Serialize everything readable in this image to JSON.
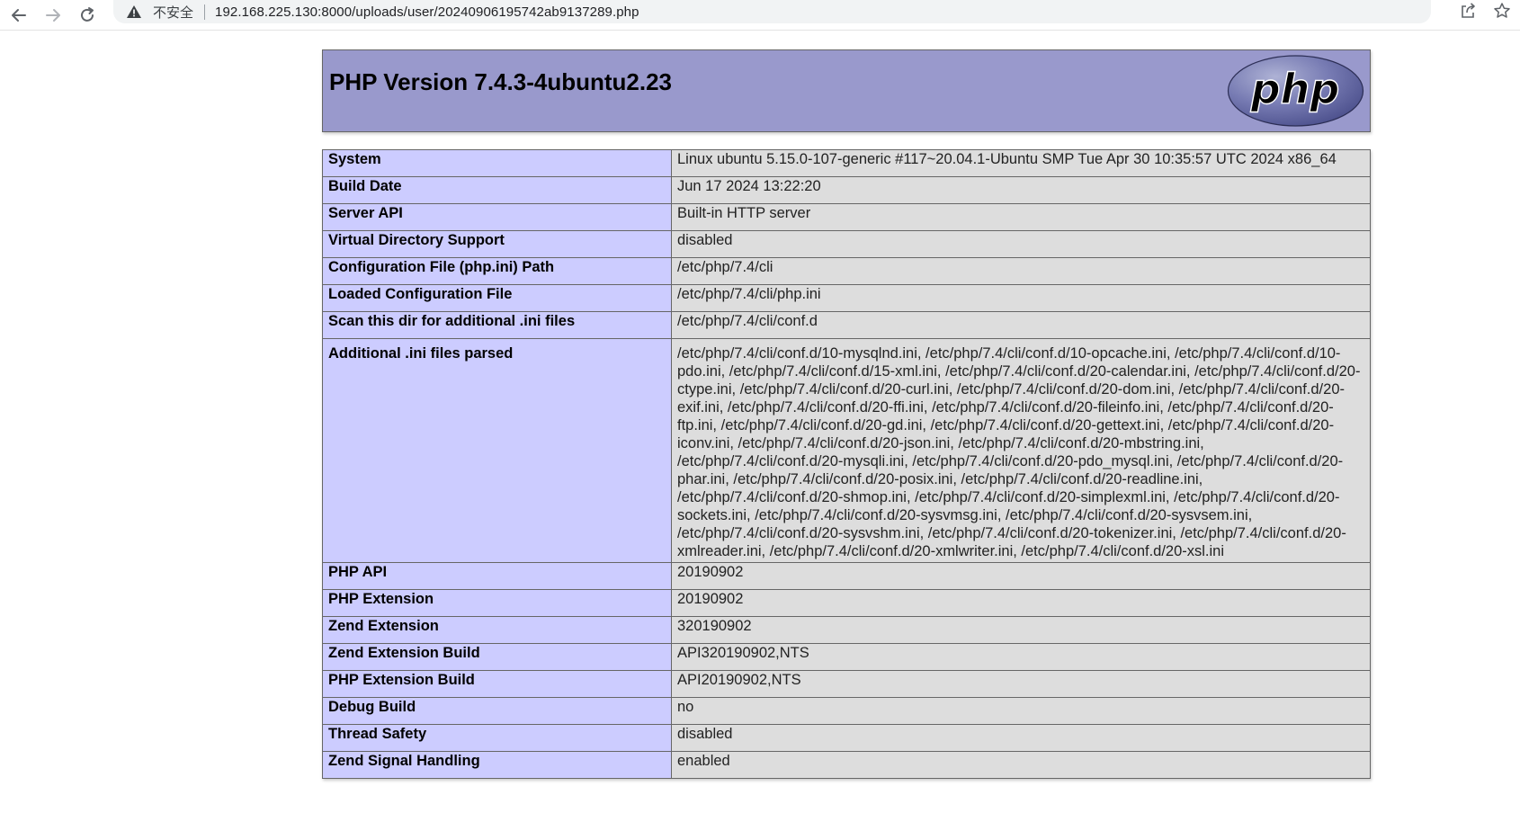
{
  "browser": {
    "insecure_label": "不安全",
    "url": "192.168.225.130:8000/uploads/user/20240906195742ab9137289.php"
  },
  "header": {
    "title": "PHP Version 7.4.3-4ubuntu2.23",
    "logo_text": "php"
  },
  "colors": {
    "header_bg": "#9999cc",
    "key_bg": "#ccccff",
    "value_bg": "#dddddd"
  },
  "rows": [
    {
      "key": "System",
      "value": "Linux ubuntu 5.15.0-107-generic #117~20.04.1-Ubuntu SMP Tue Apr 30 10:35:57 UTC 2024 x86_64"
    },
    {
      "key": "Build Date",
      "value": "Jun 17 2024 13:22:20"
    },
    {
      "key": "Server API",
      "value": "Built-in HTTP server"
    },
    {
      "key": "Virtual Directory Support",
      "value": "disabled"
    },
    {
      "key": "Configuration File (php.ini) Path",
      "value": "/etc/php/7.4/cli"
    },
    {
      "key": "Loaded Configuration File",
      "value": "/etc/php/7.4/cli/php.ini"
    },
    {
      "key": "Scan this dir for additional .ini files",
      "value": "/etc/php/7.4/cli/conf.d"
    },
    {
      "key": "Additional .ini files parsed",
      "value": "/etc/php/7.4/cli/conf.d/10-mysqlnd.ini, /etc/php/7.4/cli/conf.d/10-opcache.ini, /etc/php/7.4/cli/conf.d/10-pdo.ini, /etc/php/7.4/cli/conf.d/15-xml.ini, /etc/php/7.4/cli/conf.d/20-calendar.ini, /etc/php/7.4/cli/conf.d/20-ctype.ini, /etc/php/7.4/cli/conf.d/20-curl.ini, /etc/php/7.4/cli/conf.d/20-dom.ini, /etc/php/7.4/cli/conf.d/20-exif.ini, /etc/php/7.4/cli/conf.d/20-ffi.ini, /etc/php/7.4/cli/conf.d/20-fileinfo.ini, /etc/php/7.4/cli/conf.d/20-ftp.ini, /etc/php/7.4/cli/conf.d/20-gd.ini, /etc/php/7.4/cli/conf.d/20-gettext.ini, /etc/php/7.4/cli/conf.d/20-iconv.ini, /etc/php/7.4/cli/conf.d/20-json.ini, /etc/php/7.4/cli/conf.d/20-mbstring.ini, /etc/php/7.4/cli/conf.d/20-mysqli.ini, /etc/php/7.4/cli/conf.d/20-pdo_mysql.ini, /etc/php/7.4/cli/conf.d/20-phar.ini, /etc/php/7.4/cli/conf.d/20-posix.ini, /etc/php/7.4/cli/conf.d/20-readline.ini, /etc/php/7.4/cli/conf.d/20-shmop.ini, /etc/php/7.4/cli/conf.d/20-simplexml.ini, /etc/php/7.4/cli/conf.d/20-sockets.ini, /etc/php/7.4/cli/conf.d/20-sysvmsg.ini, /etc/php/7.4/cli/conf.d/20-sysvsem.ini, /etc/php/7.4/cli/conf.d/20-sysvshm.ini, /etc/php/7.4/cli/conf.d/20-tokenizer.ini, /etc/php/7.4/cli/conf.d/20-xmlreader.ini, /etc/php/7.4/cli/conf.d/20-xmlwriter.ini, /etc/php/7.4/cli/conf.d/20-xsl.ini"
    },
    {
      "key": "PHP API",
      "value": "20190902"
    },
    {
      "key": "PHP Extension",
      "value": "20190902"
    },
    {
      "key": "Zend Extension",
      "value": "320190902"
    },
    {
      "key": "Zend Extension Build",
      "value": "API320190902,NTS"
    },
    {
      "key": "PHP Extension Build",
      "value": "API20190902,NTS"
    },
    {
      "key": "Debug Build",
      "value": "no"
    },
    {
      "key": "Thread Safety",
      "value": "disabled"
    },
    {
      "key": "Zend Signal Handling",
      "value": "enabled"
    }
  ]
}
